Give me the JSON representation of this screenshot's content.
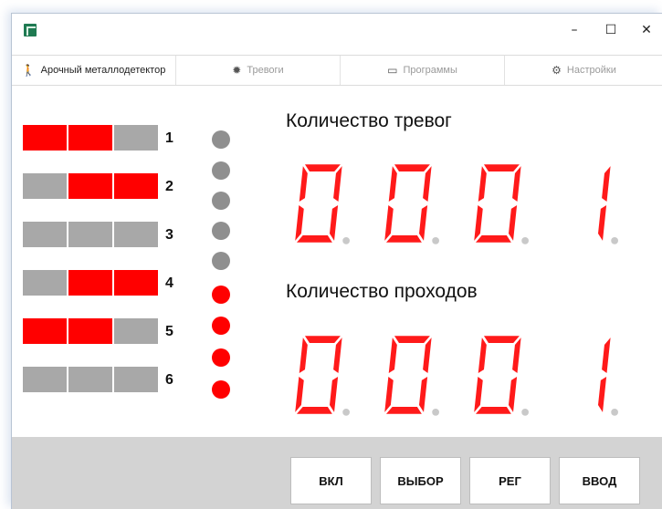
{
  "window": {
    "minimize": "–",
    "maximize": "☐",
    "close": "✕"
  },
  "tabs": [
    {
      "label": "Арочный металлодетектор",
      "icon": "walking-person-icon"
    },
    {
      "label": "Тревоги",
      "icon": "alarm-light-icon"
    },
    {
      "label": "Программы",
      "icon": "monitor-icon"
    },
    {
      "label": "Настройки",
      "icon": "gear-icon"
    }
  ],
  "zones": [
    {
      "number": "1",
      "segments": [
        true,
        true,
        false
      ]
    },
    {
      "number": "2",
      "segments": [
        false,
        true,
        true
      ]
    },
    {
      "number": "3",
      "segments": [
        false,
        false,
        false
      ]
    },
    {
      "number": "4",
      "segments": [
        false,
        true,
        true
      ]
    },
    {
      "number": "5",
      "segments": [
        true,
        true,
        false
      ]
    },
    {
      "number": "6",
      "segments": [
        false,
        false,
        false
      ]
    }
  ],
  "indicators": [
    false,
    false,
    false,
    false,
    false,
    true,
    true,
    true,
    true
  ],
  "alarms": {
    "title": "Количество тревог",
    "value": "0001"
  },
  "passes": {
    "title": "Количество проходов",
    "value": "0001"
  },
  "buttons": {
    "on": "ВКЛ",
    "select": "ВЫБОР",
    "reg": "РЕГ",
    "enter": "ВВОД"
  },
  "colors": {
    "active": "#ff0000",
    "inactive": "#a8a8a8",
    "indicator_off": "#8f8f8f"
  }
}
